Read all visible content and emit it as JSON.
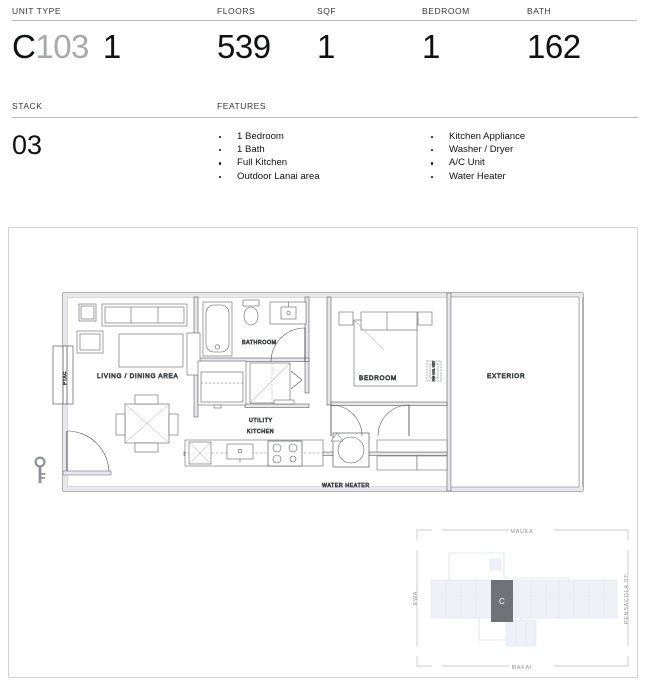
{
  "specs": {
    "columns": [
      {
        "label": "UNIT TYPE",
        "value": "C",
        "value_dim": "103",
        "value_sub": "1"
      },
      {
        "label": "FLOORS",
        "value": "539"
      },
      {
        "label": "SQF",
        "value": "1"
      },
      {
        "label": "BEDROOM",
        "value": "1"
      },
      {
        "label": "BATH",
        "value": "162"
      }
    ]
  },
  "info": {
    "stack_label": "STACK",
    "stack_value": "03",
    "features_label": "FEATURES",
    "features_col_a": [
      "1 Bedroom",
      "1 Bath",
      "Full Kitchen",
      "Outdoor Lanai area"
    ],
    "features_col_b": [
      "Kitchen Appliance",
      "Washer / Dryer",
      "A/C Unit",
      "Water  Heater"
    ]
  },
  "plan": {
    "rooms": {
      "living": "LIVING / DINING AREA",
      "bathroom": "BATHROOM",
      "utility": "UTILITY",
      "kitchen": "KITCHEN",
      "bedroom": "BEDROOM",
      "exterior": "EXTERIOR"
    },
    "annotations": {
      "ptac": "PTAC",
      "water_heater": "WATER HEATER",
      "fan_coil": "FAN COIL UNIT"
    }
  },
  "keyplan": {
    "top": "MAUKA",
    "bottom": "MAKAI",
    "left": "EWA",
    "right": "PENSACOLA ST.",
    "marker": "C"
  },
  "colors": {
    "rule": "#b9bbbd",
    "wall": "#3f4245",
    "wall_fill": "#e9e7ec",
    "furniture": "#4a4d51",
    "keyplan_block": "#eef1f7",
    "keyplan_marker": "#6f7276",
    "dim_text": "#a7a9ac"
  }
}
